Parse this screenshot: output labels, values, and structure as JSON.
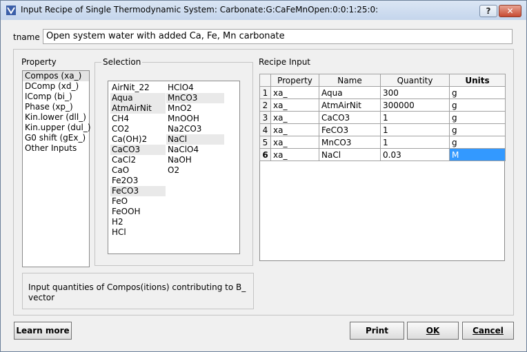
{
  "window": {
    "title": "Input Recipe of Single Thermodynamic System: Carbonate:G:CaFeMnOpen:0:0:1:25:0:",
    "help_label": "?",
    "close_label": "✕"
  },
  "tname": {
    "label": "tname",
    "value": "Open system water with added Ca, Fe, Mn carbonate"
  },
  "property": {
    "label": "Property",
    "items": [
      "Compos (xa_)",
      "DComp (xd_)",
      "IComp (bi_)",
      "Phase (xp_)",
      "Kin.lower (dll_)",
      "Kin.upper (dul_)",
      "G0 shift (gEx_)",
      "Other Inputs"
    ]
  },
  "selection": {
    "label": "Selection",
    "col1": [
      "AirNit_22",
      "Aqua",
      "AtmAirNit",
      "CH4",
      "CO2",
      "Ca(OH)2",
      "CaCO3",
      "CaCl2",
      "CaO",
      "Fe2O3",
      "FeCO3",
      "FeO",
      "FeOOH",
      "H2",
      "HCl"
    ],
    "col2": [
      "HClO4",
      "MnCO3",
      "MnO2",
      "MnOOH",
      "Na2CO3",
      "NaCl",
      "NaClO4",
      "NaOH",
      "O2"
    ]
  },
  "hint": "Input quantities of Compos(itions) contributing to B_ vector",
  "recipe": {
    "label": "Recipe Input",
    "headers": [
      "Property",
      "Name",
      "Quantity",
      "Units"
    ],
    "rows": [
      {
        "num": "1",
        "property": "xa_",
        "name": "Aqua",
        "quantity": "300",
        "units": "g"
      },
      {
        "num": "2",
        "property": "xa_",
        "name": "AtmAirNit",
        "quantity": "300000",
        "units": "g"
      },
      {
        "num": "3",
        "property": "xa_",
        "name": "CaCO3",
        "quantity": "1",
        "units": "g"
      },
      {
        "num": "4",
        "property": "xa_",
        "name": "FeCO3",
        "quantity": "1",
        "units": "g"
      },
      {
        "num": "5",
        "property": "xa_",
        "name": "MnCO3",
        "quantity": "1",
        "units": "g"
      },
      {
        "num": "6",
        "property": "xa_",
        "name": "NaCl",
        "quantity": "0.03",
        "units": "M"
      }
    ]
  },
  "buttons": {
    "learn_more": "Learn more",
    "print": "Print",
    "ok": "OK",
    "cancel": "Cancel"
  }
}
